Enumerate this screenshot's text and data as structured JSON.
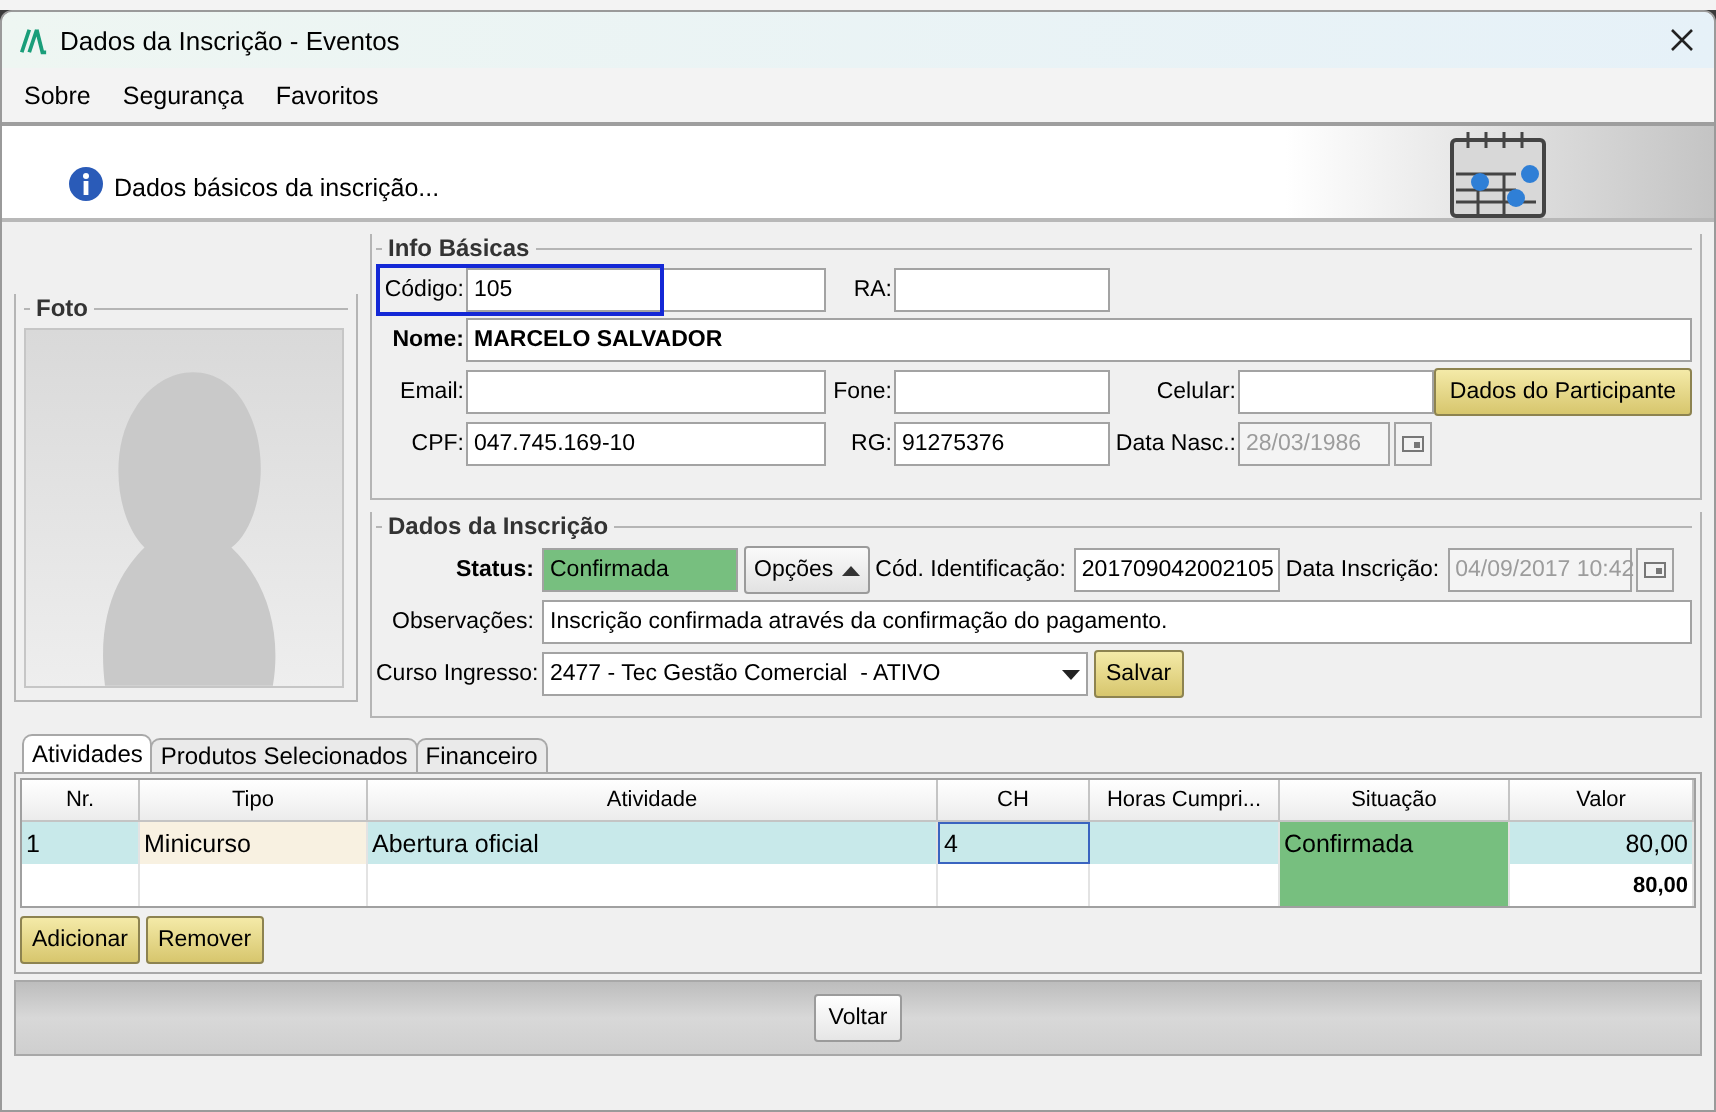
{
  "window": {
    "title": "Dados da Inscrição - Eventos"
  },
  "menu": [
    {
      "label": "Sobre"
    },
    {
      "label": "Segurança"
    },
    {
      "label": "Favoritos"
    }
  ],
  "header": {
    "text": "Dados básicos da inscrição..."
  },
  "photo": {
    "title": "Foto"
  },
  "info": {
    "title": "Info Básicas",
    "codigo": {
      "label": "Código:",
      "value": "105",
      "focused": true
    },
    "ra": {
      "label": "RA:"
    },
    "nome": {
      "label": "Nome:",
      "value": "MARCELO SALVADOR"
    },
    "email": {
      "label": "Email:"
    },
    "fone": {
      "label": "Fone:"
    },
    "celular": {
      "label": "Celular:"
    },
    "participant_button": {
      "label": "Dados do Participante"
    },
    "cpf": {
      "label": "CPF:",
      "value": "047.745.169-10"
    },
    "rg": {
      "label": "RG:",
      "value": "91275376"
    },
    "data_nasc": {
      "label": "Data Nasc.:",
      "value": "28/03/1986",
      "disabled": true
    }
  },
  "inscricao": {
    "title": "Dados da Inscrição",
    "status": {
      "label": "Status:",
      "value": "Confirmada",
      "color": "#77bf7f"
    },
    "options_button": {
      "label": "Opções"
    },
    "cod": {
      "label": "Cód. Identificação:",
      "value": "201709042002105"
    },
    "data_inscricao": {
      "label": "Data Inscrição:",
      "value": "04/09/2017 10:42",
      "disabled": true
    },
    "observacoes": {
      "label": "Observações:",
      "value": "Inscrição confirmada através da confirmação do pagamento."
    },
    "curso": {
      "label": "Curso Ingresso:",
      "value": "2477 - Tec Gestão Comercial  - ATIVO"
    },
    "save_button": {
      "label": "Salvar"
    }
  },
  "tabs": [
    {
      "label": "Atividades",
      "selected": true
    },
    {
      "label": "Produtos Selecionados",
      "selected": false
    },
    {
      "label": "Financeiro",
      "selected": false
    }
  ],
  "table": {
    "columns": [
      "Nr.",
      "Tipo",
      "Atividade",
      "CH",
      "Horas Cumpri...",
      "Situação",
      "Valor"
    ],
    "rows": [
      {
        "kind": "item",
        "selected": true,
        "nr": "1",
        "tipo": "Minicurso",
        "atividade": "Abertura oficial",
        "ch": "4",
        "ch_focused": true,
        "situacao": "Confirmada",
        "color": "#77bf7f",
        "valor": "80,00"
      },
      {
        "kind": "total",
        "selected": false,
        "color": "#77bf7f",
        "valor": "80,00"
      }
    ]
  },
  "actions": [
    {
      "label": "Adicionar"
    },
    {
      "label": "Remover"
    }
  ],
  "footer": {
    "button": {
      "label": "Voltar"
    }
  }
}
